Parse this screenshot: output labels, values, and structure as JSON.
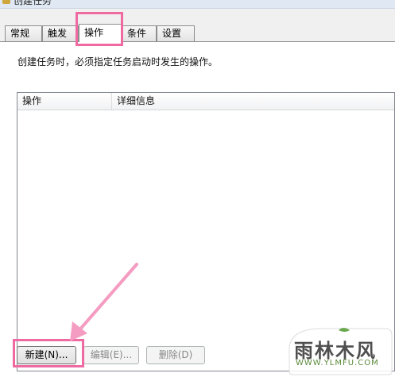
{
  "window": {
    "title": "创建任务"
  },
  "tabs": [
    {
      "label": "常规"
    },
    {
      "label": "触发器"
    },
    {
      "label": "操作"
    },
    {
      "label": "条件"
    },
    {
      "label": "设置"
    }
  ],
  "panel": {
    "description": "创建任务时，必须指定任务启动时发生的操作。",
    "columns": [
      "操作",
      "详细信息"
    ]
  },
  "buttons": {
    "new": "新建(N)...",
    "edit": "编辑(E)...",
    "delete": "删除(D)"
  },
  "watermark": {
    "text": "雨林木风",
    "url": "WWW.YLMFU.COM"
  },
  "colors": {
    "highlight": "#ee6aa1"
  }
}
